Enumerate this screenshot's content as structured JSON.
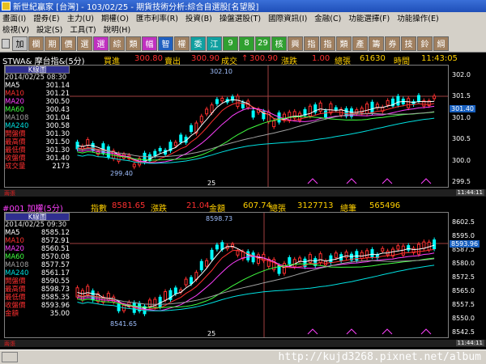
{
  "window": {
    "title": "新世紀贏家 [台灣] - 103/02/25 - 期貨技術分析:綜合自選股[名望股]"
  },
  "menu": {
    "row1": [
      "畫面(I)",
      "證券(E)",
      "主力(U)",
      "期權(O)",
      "匯市利率(R)",
      "投資(B)",
      "操盤選股(T)",
      "國際資訊(I)",
      "金融(C)",
      "功能選擇(F)",
      "功能操作(E)"
    ],
    "row2": [
      "檢視(V)",
      "設定(S)",
      "工具(T)",
      "說明(H)"
    ]
  },
  "toolbar": {
    "buttons": [
      {
        "label": "加",
        "color": "#c0c0c0",
        "text": "#000"
      },
      {
        "label": "欄",
        "color": "#a08060",
        "text": "#fff"
      },
      {
        "label": "期",
        "color": "#a08060",
        "text": "#fff"
      },
      {
        "label": "價",
        "color": "#a08060",
        "text": "#fff"
      },
      {
        "label": "選",
        "color": "#a08060",
        "text": "#fff"
      },
      {
        "label": "選",
        "color": "#c030c0",
        "text": "#fff"
      },
      {
        "label": "綜",
        "color": "#a08060",
        "text": "#fff"
      },
      {
        "label": "類",
        "color": "#a08060",
        "text": "#fff"
      },
      {
        "label": "幅",
        "color": "#c030c0",
        "text": "#fff"
      },
      {
        "label": "智",
        "color": "#2060c0",
        "text": "#fff"
      },
      {
        "label": "權",
        "color": "#a08060",
        "text": "#fff"
      },
      {
        "label": "委",
        "color": "#10a0a0",
        "text": "#fff"
      },
      {
        "label": "江",
        "color": "#10a0a0",
        "text": "#fff"
      },
      {
        "label": "9",
        "color": "#30a030",
        "text": "#fff"
      },
      {
        "label": "8",
        "color": "#30a030",
        "text": "#fff"
      },
      {
        "label": "29",
        "color": "#30a030",
        "text": "#fff"
      },
      {
        "label": "核",
        "color": "#30a030",
        "text": "#fff"
      },
      {
        "label": "興",
        "color": "#a08060",
        "text": "#fff"
      },
      {
        "label": "指",
        "color": "#a08060",
        "text": "#fff"
      },
      {
        "label": "指",
        "color": "#a08060",
        "text": "#fff"
      },
      {
        "label": "類",
        "color": "#a08060",
        "text": "#fff"
      },
      {
        "label": "產",
        "color": "#a08060",
        "text": "#fff"
      },
      {
        "label": "籌",
        "color": "#a08060",
        "text": "#fff"
      },
      {
        "label": "券",
        "color": "#a08060",
        "text": "#fff"
      },
      {
        "label": "技",
        "color": "#a08060",
        "text": "#fff"
      },
      {
        "label": "鈴",
        "color": "#a08060",
        "text": "#fff"
      },
      {
        "label": "綱",
        "color": "#a08060",
        "text": "#fff"
      }
    ]
  },
  "colors": {
    "ma5": "#ffffff",
    "ma10": "#ff3030",
    "ma20": "#ff40ff",
    "ma60": "#40ff40",
    "ma108": "#a0a0a0",
    "ma240": "#00e0e0",
    "up": "#ff3030",
    "down": "#00ffff",
    "accent": "#1860c0"
  },
  "panel1": {
    "header": {
      "symbol": "STWA& 摩台指&(5分)",
      "bid_label": "買進",
      "bid": "300.80",
      "ask_label": "賣出",
      "ask": "300.90",
      "last_label": "成交",
      "last": "300.90",
      "change_label": "漲跌",
      "change": "1.00",
      "volume_label": "總張",
      "volume": "61630",
      "time_label": "時間",
      "time": "11:43:05"
    },
    "info": {
      "title": "K線圖",
      "date": "2014/02/25 08:30",
      "rows": [
        {
          "k": "MA5",
          "v": "301.14",
          "c": "#ffffff"
        },
        {
          "k": "MA10",
          "v": "301.21",
          "c": "#ff3030"
        },
        {
          "k": "MA20",
          "v": "300.50",
          "c": "#ff40ff"
        },
        {
          "k": "MA60",
          "v": "300.43",
          "c": "#40ff40"
        },
        {
          "k": "MA108",
          "v": "301.04",
          "c": "#a0a0a0"
        },
        {
          "k": "MA240",
          "v": "300.58",
          "c": "#00e0e0"
        },
        {
          "k": "開盤價",
          "v": "301.30",
          "c": "#ff3030"
        },
        {
          "k": "最高價",
          "v": "301.50",
          "c": "#ff3030"
        },
        {
          "k": "最低價",
          "v": "301.30",
          "c": "#ff3030"
        },
        {
          "k": "收盤價",
          "v": "301.40",
          "c": "#ff3030"
        },
        {
          "k": "成交量",
          "v": "2173",
          "c": "#ff3030"
        }
      ]
    },
    "yaxis": {
      "labels": [
        "302.0",
        "301.5",
        "301.0",
        "300.5",
        "300.0",
        "299.5"
      ],
      "current": "301.40"
    },
    "annotations": {
      "high": "302.10",
      "low": "299.40",
      "day": "25"
    },
    "footer": {
      "left": "兩張",
      "right": "11:44:11"
    }
  },
  "panel2": {
    "header": {
      "symbol": "#001 加權(5分)",
      "index_label": "指數",
      "index": "8581.65",
      "change_label": "漲跌",
      "change": "21.04",
      "amount_label": "金額",
      "amount": "607.74",
      "total_label": "總張",
      "total": "3127713",
      "count_label": "總筆",
      "count": "565496"
    },
    "info": {
      "title": "K線圖",
      "date": "2014/02/25 09:30",
      "rows": [
        {
          "k": "MA5",
          "v": "8585.12",
          "c": "#ffffff"
        },
        {
          "k": "MA10",
          "v": "8572.91",
          "c": "#ff3030"
        },
        {
          "k": "MA20",
          "v": "8560.51",
          "c": "#ff40ff"
        },
        {
          "k": "MA60",
          "v": "8570.08",
          "c": "#40ff40"
        },
        {
          "k": "MA108",
          "v": "8577.57",
          "c": "#a0a0a0"
        },
        {
          "k": "MA240",
          "v": "8561.17",
          "c": "#00e0e0"
        },
        {
          "k": "開盤價",
          "v": "8590.55",
          "c": "#ff3030"
        },
        {
          "k": "最高價",
          "v": "8598.73",
          "c": "#ff3030"
        },
        {
          "k": "最低價",
          "v": "8585.35",
          "c": "#ff3030"
        },
        {
          "k": "收盤價",
          "v": "8593.96",
          "c": "#ff3030"
        },
        {
          "k": "金額",
          "v": "35.00",
          "c": "#ff3030"
        }
      ]
    },
    "yaxis": {
      "labels": [
        "8602.5",
        "8595.0",
        "8587.5",
        "8580.0",
        "8572.5",
        "8565.0",
        "8557.5",
        "8550.0",
        "8542.5"
      ],
      "current": "8593.96"
    },
    "annotations": {
      "high": "8598.73",
      "low": "8541.65",
      "day": "25"
    },
    "footer": {
      "left": "兩張",
      "right": "11:44:11"
    }
  },
  "statusbar": {
    "watermark": "http://kujd3268.pixnet.net/album"
  }
}
